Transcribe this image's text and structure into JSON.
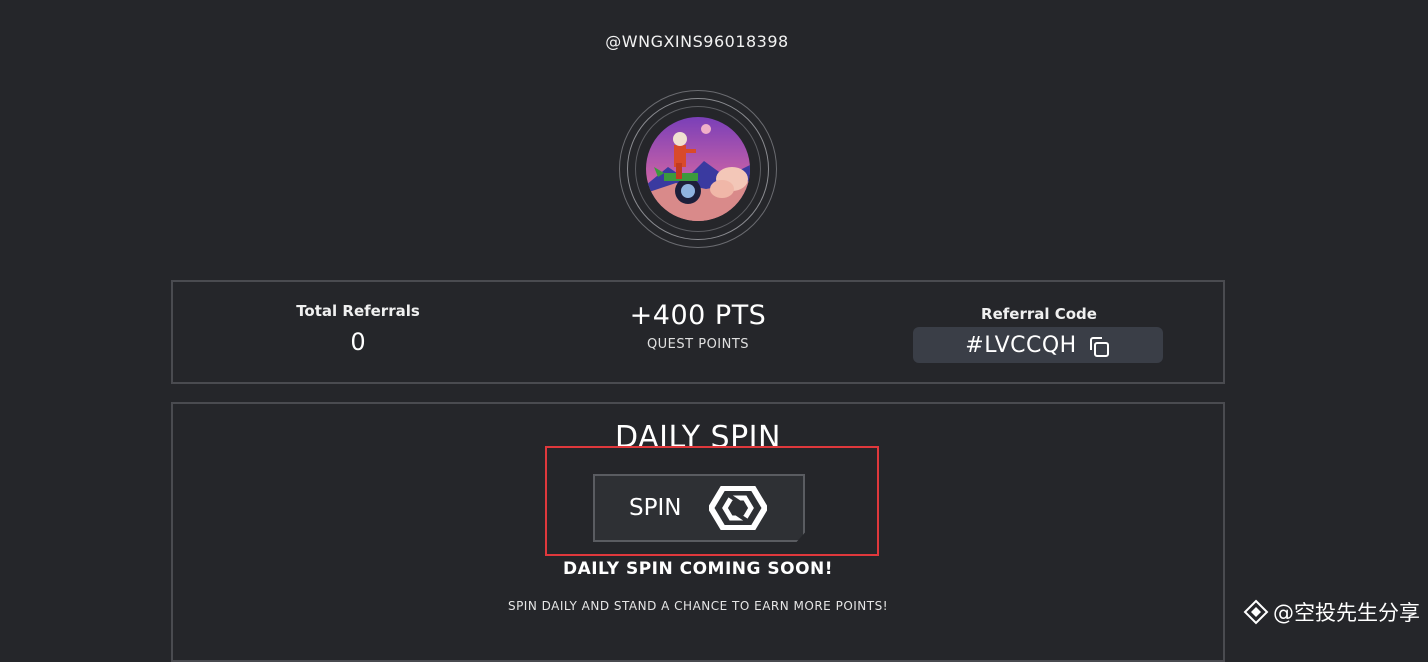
{
  "profile": {
    "username": "@WNGXINS96018398"
  },
  "stats": {
    "referrals_label": "Total Referrals",
    "referrals_value": "0",
    "points_value": "+400 PTS",
    "points_label": "QUEST POINTS",
    "code_label": "Referral Code",
    "code_value": "#LVCCQH"
  },
  "daily_spin": {
    "title": "DAILY SPIN",
    "button_label": "SPIN",
    "coming_soon": "DAILY SPIN COMING SOON!",
    "description": "SPIN DAILY AND STAND A CHANCE TO EARN MORE POINTS!"
  },
  "watermark": {
    "text": "@空投先生分享"
  },
  "icons": {
    "copy": "copy-icon",
    "spin_logo": "spin-logo-icon",
    "binance_square": "binance-square-icon"
  },
  "colors": {
    "background": "#25262a",
    "border": "#4a4b50",
    "code_pill": "#3a3e47",
    "highlight": "#e0383c"
  }
}
